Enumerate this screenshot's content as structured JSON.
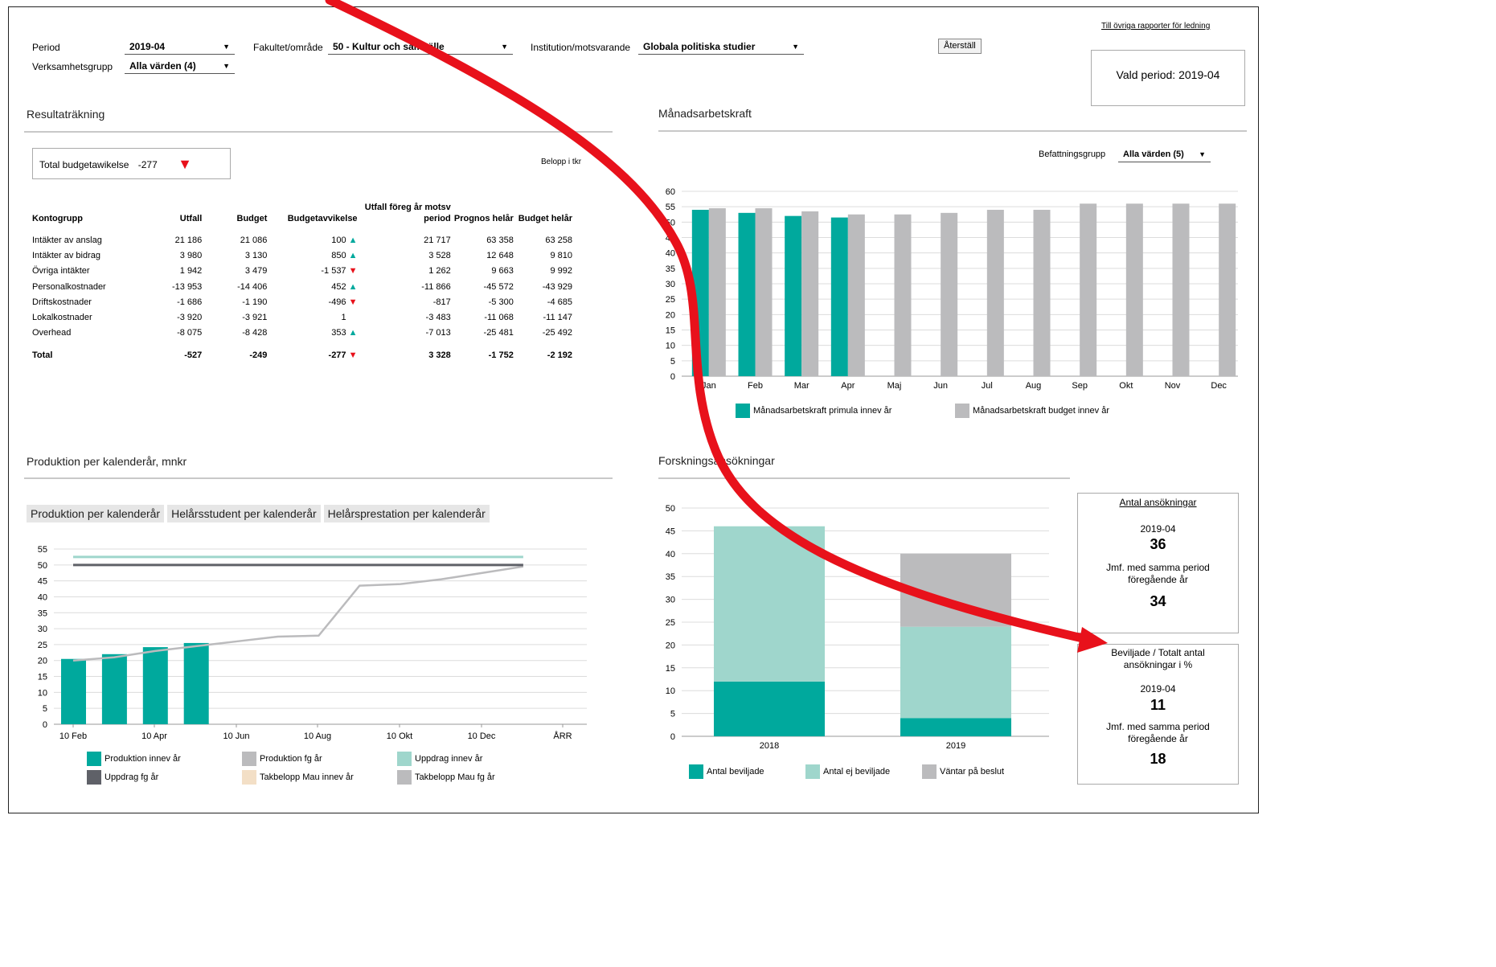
{
  "filters": {
    "period_label": "Period",
    "period_value": "2019-04",
    "verksamhet_label": "Verksamhetsgrupp",
    "verksamhet_value": "Alla värden (4)",
    "fakultet_label": "Fakultet/område",
    "fakultet_value": "50 - Kultur och samhälle",
    "institution_label": "Institution/motsvarande",
    "institution_value": "Globala politiska studier",
    "reset_label": "Återställ",
    "other_reports_link": "Till övriga rapporter för ledning",
    "selected_period": "Vald period: 2019-04"
  },
  "resultat": {
    "title": "Resultaträkning",
    "total_label": "Total budgetawikelse",
    "total_value": "-277",
    "amount_note": "Belopp i tkr",
    "headers": [
      "Kontogrupp",
      "Utfall",
      "Budget",
      "Budgetavvikelse",
      "Utfall föreg år motsv period",
      "Prognos helår",
      "Budget helår"
    ],
    "rows": [
      {
        "name": "Intäkter av anslag",
        "utfall": "21 186",
        "budget": "21 086",
        "avv": "100",
        "trend": "up",
        "fg": "21 717",
        "prognos": "63 358",
        "helar": "63 258"
      },
      {
        "name": "Intäkter av bidrag",
        "utfall": "3 980",
        "budget": "3 130",
        "avv": "850",
        "trend": "up",
        "fg": "3 528",
        "prognos": "12 648",
        "helar": "9 810"
      },
      {
        "name": "Övriga intäkter",
        "utfall": "1 942",
        "budget": "3 479",
        "avv": "-1 537",
        "trend": "down",
        "fg": "1 262",
        "prognos": "9 663",
        "helar": "9 992"
      },
      {
        "name": "Personalkostnader",
        "utfall": "-13 953",
        "budget": "-14 406",
        "avv": "452",
        "trend": "up",
        "fg": "-11 866",
        "prognos": "-45 572",
        "helar": "-43 929"
      },
      {
        "name": "Driftskostnader",
        "utfall": "-1 686",
        "budget": "-1 190",
        "avv": "-496",
        "trend": "down",
        "fg": "-817",
        "prognos": "-5 300",
        "helar": "-4 685"
      },
      {
        "name": "Lokalkostnader",
        "utfall": "-3 920",
        "budget": "-3 921",
        "avv": "1",
        "trend": "none",
        "fg": "-3 483",
        "prognos": "-11 068",
        "helar": "-11 147"
      },
      {
        "name": "Overhead",
        "utfall": "-8 075",
        "budget": "-8 428",
        "avv": "353",
        "trend": "up",
        "fg": "-7 013",
        "prognos": "-25 481",
        "helar": "-25 492"
      }
    ],
    "total_row": {
      "name": "Total",
      "utfall": "-527",
      "budget": "-249",
      "avv": "-277",
      "trend": "down",
      "fg": "3 328",
      "prognos": "-1 752",
      "helar": "-2 192"
    }
  },
  "manad": {
    "title": "Månadsarbetskraft",
    "befattning_label": "Befattningsgrupp",
    "befattning_value": "Alla värden (5)"
  },
  "produktion": {
    "title": "Produktion per kalenderår, mnkr",
    "tabs": [
      "Produktion per kalenderår",
      "Helårsstudent per kalenderår",
      "Helårsprestation per kalenderår"
    ]
  },
  "forskning": {
    "title": "Forskningsansökningar",
    "antal_title": "Antal ansökningar",
    "antal_period": "2019-04",
    "antal_value": "36",
    "antal_cmp_label": "Jmf. med samma period föregående år",
    "antal_cmp_value": "34",
    "bev_title": "Beviljade / Totalt antal ansökningar i %",
    "bev_period": "2019-04",
    "bev_value": "11",
    "bev_cmp_label": "Jmf. med samma period föregående år",
    "bev_cmp_value": "18"
  },
  "colors": {
    "teal": "#00a99d",
    "light_teal": "#9fd6cc",
    "gray": "#bbbbbd",
    "dark_gray": "#5f6168",
    "beige": "#f3dfc6",
    "red": "#e8111b"
  },
  "chart_data": [
    {
      "type": "bar",
      "categories": [
        "Jan",
        "Feb",
        "Mar",
        "Apr",
        "Maj",
        "Jun",
        "Jul",
        "Aug",
        "Sep",
        "Okt",
        "Nov",
        "Dec"
      ],
      "series": [
        {
          "name": "Månadsarbetskraft primula innev år",
          "values": [
            54,
            53,
            52,
            51.5,
            null,
            null,
            null,
            null,
            null,
            null,
            null,
            null
          ]
        },
        {
          "name": "Månadsarbetskraft budget innev år",
          "values": [
            54.5,
            54.5,
            53.5,
            52.5,
            52.5,
            53,
            54,
            54,
            56,
            56,
            56,
            56
          ]
        }
      ],
      "ylim": [
        0,
        60
      ],
      "yticks": [
        "0",
        "5",
        "10",
        "15",
        "20",
        "25",
        "30",
        "35",
        "40",
        "45",
        "50",
        "55",
        "60"
      ],
      "grid": true,
      "legend": "bottom"
    },
    {
      "type": "bar",
      "x_ticks": [
        "10 Feb",
        "10 Apr",
        "10 Jun",
        "10 Aug",
        "10 Okt",
        "10 Dec",
        "ÅRR"
      ],
      "bars": {
        "name": "Produktion innev år",
        "months": [
          1,
          2,
          3,
          4
        ],
        "values": [
          20.5,
          22,
          24.2,
          25.5
        ]
      },
      "lines": [
        {
          "name": "Produktion fg år",
          "months": [
            1,
            2,
            3,
            4,
            5,
            6,
            7,
            8,
            9,
            10,
            11,
            12
          ],
          "values": [
            20,
            21,
            23,
            24.5,
            26,
            27.5,
            27.8,
            43.5,
            44,
            45.5,
            47.5,
            49.5
          ]
        },
        {
          "name": "Uppdrag innev år",
          "months": [
            1,
            12
          ],
          "values": [
            52.5,
            52.5
          ]
        },
        {
          "name": "Uppdrag fg år",
          "months": [
            1,
            12
          ],
          "values": [
            50,
            50
          ]
        }
      ],
      "legend_entries": [
        "Produktion innev år",
        "Produktion fg år",
        "Uppdrag innev år",
        "Uppdrag fg år",
        "Takbelopp Mau innev år",
        "Takbelopp Mau fg år"
      ],
      "ylim": [
        0,
        55
      ],
      "yticks": [
        "0",
        "5",
        "10",
        "15",
        "20",
        "25",
        "30",
        "35",
        "40",
        "45",
        "50",
        "55"
      ],
      "grid": true,
      "legend": "bottom"
    },
    {
      "type": "bar",
      "stacked": true,
      "categories": [
        "2018",
        "2019"
      ],
      "series": [
        {
          "name": "Antal beviljade",
          "values": [
            12,
            4
          ]
        },
        {
          "name": "Antal ej beviljade",
          "values": [
            34,
            20
          ]
        },
        {
          "name": "Väntar på beslut",
          "values": [
            0,
            16
          ]
        }
      ],
      "ylim": [
        0,
        50
      ],
      "yticks": [
        "0",
        "5",
        "10",
        "15",
        "20",
        "25",
        "30",
        "35",
        "40",
        "45",
        "50"
      ],
      "grid": true,
      "legend": "bottom"
    }
  ]
}
